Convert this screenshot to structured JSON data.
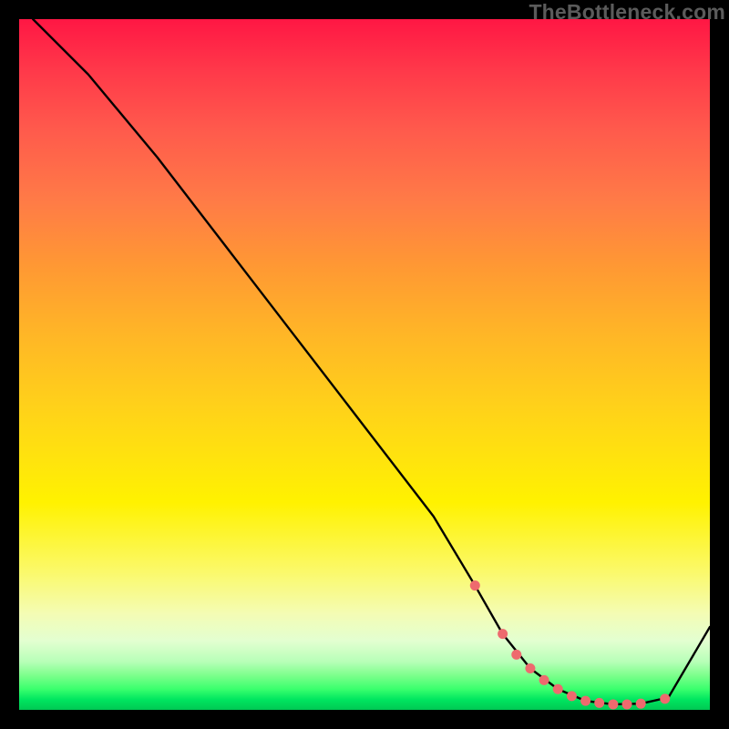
{
  "watermark": "TheBottleneck.com",
  "chart_data": {
    "type": "line",
    "title": "",
    "xlabel": "",
    "ylabel": "",
    "xlim": [
      0,
      100
    ],
    "ylim": [
      0,
      100
    ],
    "grid": false,
    "series": [
      {
        "name": "curve",
        "color": "#000000",
        "x": [
          2,
          10,
          20,
          30,
          40,
          50,
          60,
          66,
          70,
          74,
          78,
          82,
          86,
          90,
          94,
          100
        ],
        "y": [
          100,
          92,
          80,
          67,
          54,
          41,
          28,
          18,
          11,
          6,
          3,
          1.3,
          0.8,
          0.9,
          1.8,
          12
        ]
      }
    ],
    "markers": {
      "name": "highlighted-points",
      "color": "#ee6a6e",
      "radius_px": 5.5,
      "x": [
        66,
        70,
        72,
        74,
        76,
        78,
        80,
        82,
        84,
        86,
        88,
        90,
        93.5
      ],
      "y": [
        18,
        11,
        8,
        6,
        4.3,
        3,
        2,
        1.3,
        1,
        0.8,
        0.8,
        0.9,
        1.6
      ]
    }
  }
}
